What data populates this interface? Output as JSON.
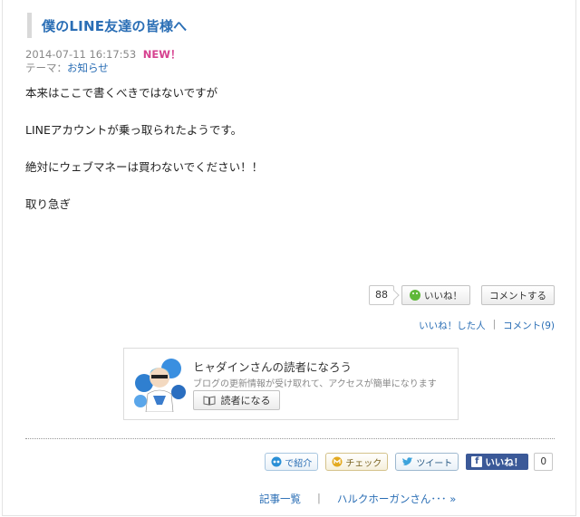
{
  "article": {
    "title": "僕のLINE友達の皆様へ",
    "datetime": "2014-07-11 16:17:53",
    "new_badge": "NEW！",
    "theme_label": "テーマ：",
    "theme_link": "お知らせ",
    "body": [
      "本来はここで書くべきではないですが",
      "LINEアカウントが乗っ取られたようです。",
      "絶対にウェブマネーは買わないでください！！",
      "取り急ぎ"
    ]
  },
  "reactions": {
    "like_count": "88",
    "like_button": "いいね！",
    "comment_button": "コメントする",
    "liked_by_link": "いいね！した人",
    "separator": "|",
    "comments_link": "コメント(9)"
  },
  "reader": {
    "title": "ヒャダインさんの読者になろう",
    "description": "ブログの更新情報が受け取れて、アクセスが簡単になります",
    "button": "読者になる"
  },
  "share": {
    "intro": "で紹介",
    "check": "チェック",
    "tweet": "ツイート",
    "fb_like": "いいね！",
    "fb_count": "0"
  },
  "nav": {
    "list_link": "記事一覧",
    "separator": "|",
    "next_link": "ハルクホーガンさん･･･ »"
  },
  "colors": {
    "link": "#2a6eb5",
    "new": "#d6418f",
    "facebook": "#3b5998"
  }
}
